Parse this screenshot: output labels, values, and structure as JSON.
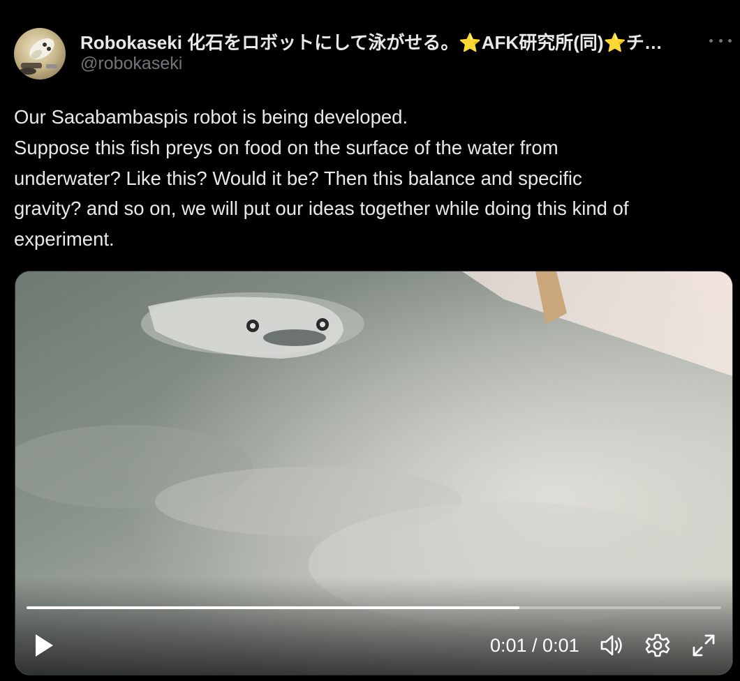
{
  "author": {
    "display_name": "Robokaseki 化石をロボットにして泳がせる。⭐AFK研究所(同)⭐チ…",
    "handle": "@robokaseki",
    "avatar_icon": "avatar-robot-fossil-icon"
  },
  "tweet": {
    "lines": [
      "Our  Sacabambaspis robot is being developed.",
      "Suppose this fish preys on food on the surface of the water from",
      "underwater? Like this? Would it be? Then this balance and specific",
      "gravity? and so on, we will put our ideas together while doing this kind of",
      "experiment."
    ]
  },
  "video": {
    "time_display": "0:01 / 0:01",
    "progress": 0.71,
    "icons": {
      "play": "play-icon",
      "volume": "volume-icon",
      "settings": "gear-icon",
      "fullscreen": "fullscreen-icon",
      "more": "more-icon"
    }
  },
  "colors": {
    "background": "#000000",
    "text": "#e7e9ea",
    "secondary_text": "#71767b"
  }
}
